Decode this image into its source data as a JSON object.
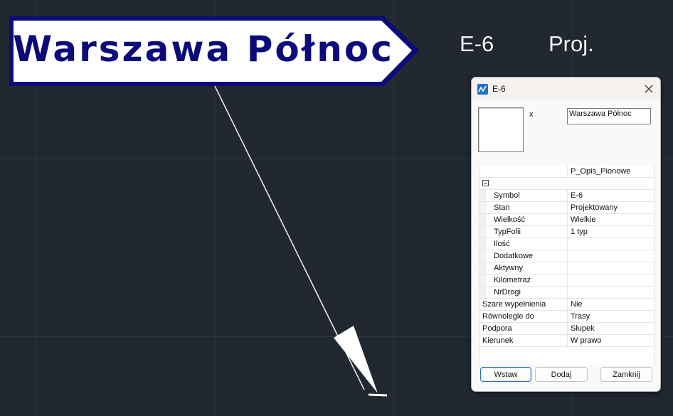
{
  "canvas": {
    "sign_text": "Warszawa Północ",
    "label_symbol": "E-6",
    "label_state": "Proj."
  },
  "dialog": {
    "title": "E-6",
    "app_icon": "app-logo-icon",
    "close_icon": "close-icon",
    "x_label": "x",
    "text_value": "Warszawa Północ",
    "style_value": "P_Opis_Pionowe",
    "properties": [
      {
        "name": "Symbol",
        "value": "E-6",
        "indented": true
      },
      {
        "name": "Stan",
        "value": "Projektowany",
        "indented": true
      },
      {
        "name": "Wielkość",
        "value": "Wielkie",
        "indented": true
      },
      {
        "name": "TypFolii",
        "value": "1 typ",
        "indented": true
      },
      {
        "name": "Ilość",
        "value": "",
        "indented": true
      },
      {
        "name": "Dodatkowe",
        "value": "",
        "indented": true
      },
      {
        "name": "Aktywny",
        "value": "",
        "indented": true
      },
      {
        "name": "Kilometraż",
        "value": "",
        "indented": true
      },
      {
        "name": "NrDrogi",
        "value": "",
        "indented": true
      },
      {
        "name": "Szare wypełnienia",
        "value": "Nie",
        "indented": false
      },
      {
        "name": "Równolegle do",
        "value": "Trasy",
        "indented": false
      },
      {
        "name": "Podpora",
        "value": "Słupek",
        "indented": false
      },
      {
        "name": "Kierunek",
        "value": "W prawo",
        "indented": false
      }
    ],
    "buttons": {
      "insert": "Wstaw",
      "add": "Dodaj",
      "close": "Zamknij"
    }
  },
  "colors": {
    "background": "#212830",
    "sign_border": "#0b0b7a",
    "sign_text": "#0b0b7a",
    "accent": "#2f6fc6"
  }
}
